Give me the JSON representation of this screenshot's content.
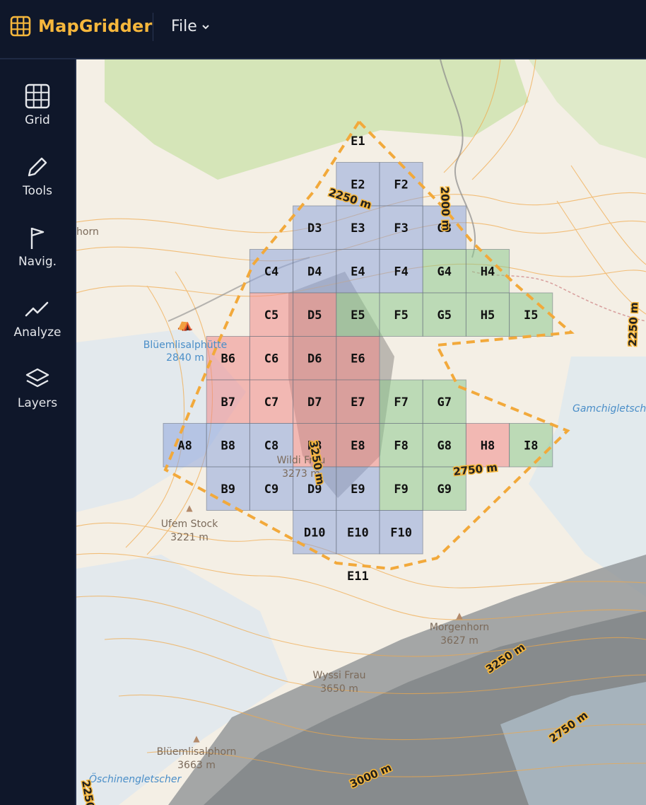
{
  "app": {
    "name": "MapGridder",
    "file_menu": "File"
  },
  "colors": {
    "accent": "#f6b73c",
    "cell_blue": "#8fa6dd",
    "cell_green": "#8ec98f",
    "cell_red": "#f08a8a",
    "boundary": "#f2a93b"
  },
  "sidebar": {
    "items": [
      {
        "label": "Grid",
        "icon": "grid-icon"
      },
      {
        "label": "Tools",
        "icon": "pencil-icon"
      },
      {
        "label": "Navig.",
        "icon": "flag-icon"
      },
      {
        "label": "Analyze",
        "icon": "chart-line-icon"
      },
      {
        "label": "Layers",
        "icon": "layers-icon"
      }
    ]
  },
  "map": {
    "peaks": [
      {
        "name": "Wildi Frau",
        "elev": "3273 m"
      },
      {
        "name": "Ufem Stock",
        "elev": "3221 m"
      },
      {
        "name": "Morgenhorn",
        "elev": "3627 m"
      },
      {
        "name": "Wyssi Frau",
        "elev": "3650 m"
      },
      {
        "name": "Blüemlisalphorn",
        "elev": "3663 m"
      }
    ],
    "hut": {
      "name": "Blüemlisalphütte",
      "elev": "2840 m"
    },
    "glaciers": [
      "Gamchigletscher",
      "Öschinengletscher"
    ],
    "contours": [
      "2250 m",
      "2000 m",
      "2250 m",
      "3250 m",
      "2750 m",
      "2750 m",
      "3000 m",
      "3250 m"
    ],
    "fragment": "horn"
  },
  "grid": {
    "cells": [
      {
        "id": "E1",
        "status": "none"
      },
      {
        "id": "E2",
        "status": "blue"
      },
      {
        "id": "F2",
        "status": "blue"
      },
      {
        "id": "D3",
        "status": "blue"
      },
      {
        "id": "E3",
        "status": "blue"
      },
      {
        "id": "F3",
        "status": "blue"
      },
      {
        "id": "G3",
        "status": "blue"
      },
      {
        "id": "C4",
        "status": "blue"
      },
      {
        "id": "D4",
        "status": "blue"
      },
      {
        "id": "E4",
        "status": "blue"
      },
      {
        "id": "F4",
        "status": "blue"
      },
      {
        "id": "G4",
        "status": "green"
      },
      {
        "id": "H4",
        "status": "green"
      },
      {
        "id": "C5",
        "status": "red"
      },
      {
        "id": "D5",
        "status": "red"
      },
      {
        "id": "E5",
        "status": "green"
      },
      {
        "id": "F5",
        "status": "green"
      },
      {
        "id": "G5",
        "status": "green"
      },
      {
        "id": "H5",
        "status": "green"
      },
      {
        "id": "I5",
        "status": "green"
      },
      {
        "id": "B6",
        "status": "red"
      },
      {
        "id": "C6",
        "status": "red"
      },
      {
        "id": "D6",
        "status": "red"
      },
      {
        "id": "E6",
        "status": "red"
      },
      {
        "id": "B7",
        "status": "red"
      },
      {
        "id": "C7",
        "status": "red"
      },
      {
        "id": "D7",
        "status": "red"
      },
      {
        "id": "E7",
        "status": "red"
      },
      {
        "id": "F7",
        "status": "green"
      },
      {
        "id": "G7",
        "status": "green"
      },
      {
        "id": "A8",
        "status": "blue"
      },
      {
        "id": "B8",
        "status": "blue"
      },
      {
        "id": "C8",
        "status": "blue"
      },
      {
        "id": "D8",
        "status": "red"
      },
      {
        "id": "E8",
        "status": "red"
      },
      {
        "id": "F8",
        "status": "green"
      },
      {
        "id": "G8",
        "status": "green"
      },
      {
        "id": "H8",
        "status": "red"
      },
      {
        "id": "I8",
        "status": "green"
      },
      {
        "id": "B9",
        "status": "blue"
      },
      {
        "id": "C9",
        "status": "blue"
      },
      {
        "id": "D9",
        "status": "blue"
      },
      {
        "id": "E9",
        "status": "blue"
      },
      {
        "id": "F9",
        "status": "green"
      },
      {
        "id": "G9",
        "status": "green"
      },
      {
        "id": "D10",
        "status": "blue"
      },
      {
        "id": "E10",
        "status": "blue"
      },
      {
        "id": "F10",
        "status": "blue"
      },
      {
        "id": "E11",
        "status": "none"
      }
    ]
  }
}
